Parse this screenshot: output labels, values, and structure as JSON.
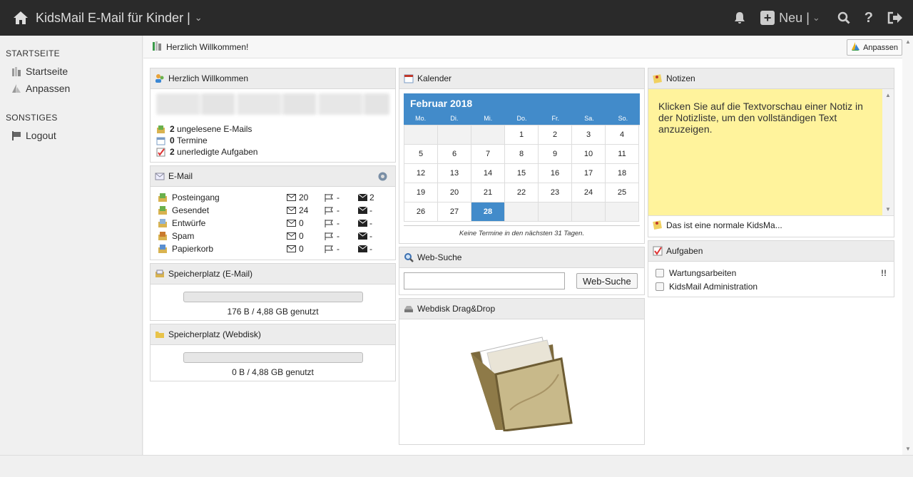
{
  "app": {
    "title": "KidsMail E-Mail für Kinder |",
    "new_label": "Neu |"
  },
  "sidebar": {
    "section1": "STARTSEITE",
    "items1": [
      {
        "label": "Startseite"
      },
      {
        "label": "Anpassen"
      }
    ],
    "section2": "SONSTIGES",
    "items2": [
      {
        "label": "Logout"
      }
    ]
  },
  "page": {
    "title": "Herzlich Willkommen!",
    "customize_label": "Anpassen"
  },
  "welcome": {
    "title": "Herzlich Willkommen",
    "unread_count": "2",
    "unread_label": "ungelesene E-Mails",
    "appointments_count": "0",
    "appointments_label": "Termine",
    "tasks_count": "2",
    "tasks_label": "unerledigte Aufgaben"
  },
  "email": {
    "title": "E-Mail",
    "folders": [
      {
        "name": "Posteingang",
        "total": "20",
        "flagged": "-",
        "unread": "2"
      },
      {
        "name": "Gesendet",
        "total": "24",
        "flagged": "-",
        "unread": "-"
      },
      {
        "name": "Entwürfe",
        "total": "0",
        "flagged": "-",
        "unread": "-"
      },
      {
        "name": "Spam",
        "total": "0",
        "flagged": "-",
        "unread": "-"
      },
      {
        "name": "Papierkorb",
        "total": "0",
        "flagged": "-",
        "unread": "-"
      }
    ]
  },
  "storage_mail": {
    "title": "Speicherplatz (E-Mail)",
    "usage": "176 B / 4,88 GB genutzt",
    "fraction": 0.0
  },
  "storage_disk": {
    "title": "Speicherplatz (Webdisk)",
    "usage": "0 B / 4,88 GB genutzt",
    "fraction": 0.0
  },
  "calendar": {
    "title": "Kalender",
    "month": "Februar 2018",
    "weekdays": [
      "Mo.",
      "Di.",
      "Mi.",
      "Do.",
      "Fr.",
      "Sa.",
      "So."
    ],
    "leading_blanks": 3,
    "days": 28,
    "today": 28,
    "note": "Keine Termine in den nächsten 31 Tagen."
  },
  "websearch": {
    "title": "Web-Suche",
    "button_label": "Web-Suche",
    "value": ""
  },
  "webdisk": {
    "title": "Webdisk Drag&Drop"
  },
  "notes": {
    "title": "Notizen",
    "preview": "Klicken Sie auf die Textvorschau einer Notiz in der Notizliste, um den vollständigen Text anzuzeigen.",
    "items": [
      {
        "label": "Das ist eine normale KidsMa..."
      }
    ]
  },
  "tasks": {
    "title": "Aufgaben",
    "items": [
      {
        "label": "Wartungsarbeiten",
        "priority": "!!"
      },
      {
        "label": "KidsMail Administration",
        "priority": ""
      }
    ]
  }
}
